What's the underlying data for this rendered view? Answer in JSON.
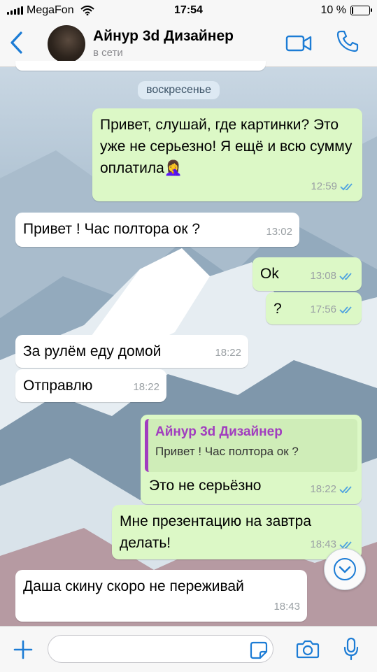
{
  "status_bar": {
    "carrier": "MegaFon",
    "time": "17:54",
    "battery_text": "10 %",
    "battery_level": 0.1
  },
  "header": {
    "contact_name": "Айнур 3d Дизайнер",
    "status": "в сети"
  },
  "date_label": "воскресенье",
  "messages": [
    {
      "dir": "out",
      "text": "Привет, слушай, где картинки? Это уже не серьезно! Я ещё и всю сумму оплатила🤦‍♀️",
      "time": "12:59",
      "read": true
    },
    {
      "dir": "in",
      "text": "Привет ! Час полтора ок ?",
      "time": "13:02"
    },
    {
      "dir": "out",
      "text": "Ok",
      "time": "13:08",
      "read": true
    },
    {
      "dir": "out",
      "text": "?",
      "time": "17:56",
      "read": true
    },
    {
      "dir": "in",
      "text": "За рулём еду домой",
      "time": "18:22"
    },
    {
      "dir": "in",
      "text": "Отправлю",
      "time": "18:22"
    },
    {
      "dir": "out",
      "quote_author": "Айнур 3d Дизайнер",
      "quote_text": "Привет ! Час полтора ок ?",
      "text": "Это не серьёзно",
      "time": "18:22",
      "read": true
    },
    {
      "dir": "out",
      "text": "Мне презентацию на завтра делать!",
      "time": "18:43",
      "read": true
    },
    {
      "dir": "in",
      "text": "Даша скину скоро не переживай",
      "time": "18:43"
    }
  ],
  "input": {
    "value": "",
    "placeholder": ""
  },
  "colors": {
    "accent": "#1c7cd5",
    "outgoing": "#dcf8c6",
    "incoming": "#ffffff",
    "quote_author": "#a13dbf",
    "read_ticks": "#4fa3e0"
  },
  "icons": [
    "back-arrow-icon",
    "video-call-icon",
    "phone-icon",
    "chevron-down-icon",
    "plus-icon",
    "sticker-icon",
    "camera-icon",
    "microphone-icon",
    "double-check-icon"
  ]
}
